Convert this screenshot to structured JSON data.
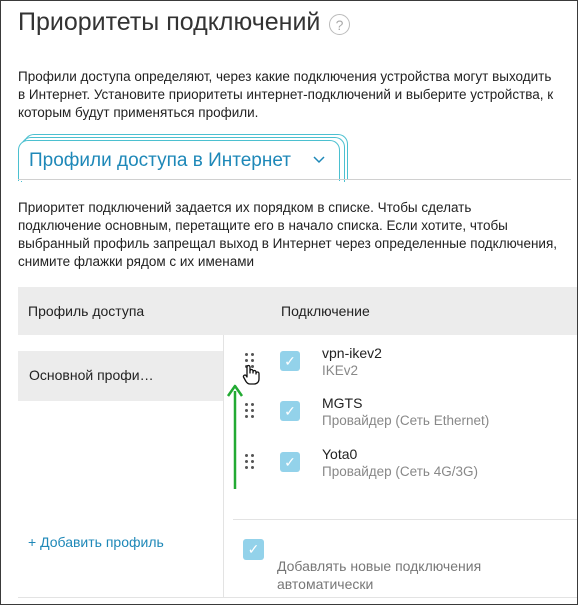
{
  "page": {
    "title": "Приоритеты подключений",
    "help_icon": "?",
    "description": "Профили доступа определяют, через какие подключения устройства могут выходить в Интернет. Установите приоритеты интернет-подключений и выберите устройства, к которым будут применяться профили."
  },
  "tab": {
    "label": "Профили доступа в Интернет",
    "chevron": "⌵"
  },
  "hint": "Приоритет подключений задается их порядком в списке. Чтобы сделать подключение основным, перетащите его в начало списка. Если хотите, чтобы выбранный профиль запрещал выход в Интернет через определенные подключения, снимите флажки рядом с их именами",
  "table": {
    "col_profile": "Профиль доступа",
    "col_connection": "Подключение"
  },
  "profiles": [
    {
      "label": "Основной профи…"
    }
  ],
  "add_profile": "+ Добавить профиль",
  "connections": [
    {
      "name": "vpn-ikev2",
      "type": "IKEv2",
      "checked": true
    },
    {
      "name": "MGTS",
      "type": "Провайдер (Сеть Ethernet)",
      "checked": true
    },
    {
      "name": "Yota0",
      "type": "Провайдер (Сеть 4G/3G)",
      "checked": true
    }
  ],
  "auto_add": {
    "label": "Добавлять новые подключения автоматически",
    "checked": true
  },
  "colors": {
    "accent": "#1e88b8",
    "checkbox": "#93d2ea",
    "tab_border": "#4bc0d0",
    "arrow": "#22aa33"
  },
  "icons": {
    "check": "✓",
    "drag_handle": "grip-icon",
    "cursor": "hand-cursor-icon",
    "arrow": "arrow-up-icon"
  }
}
